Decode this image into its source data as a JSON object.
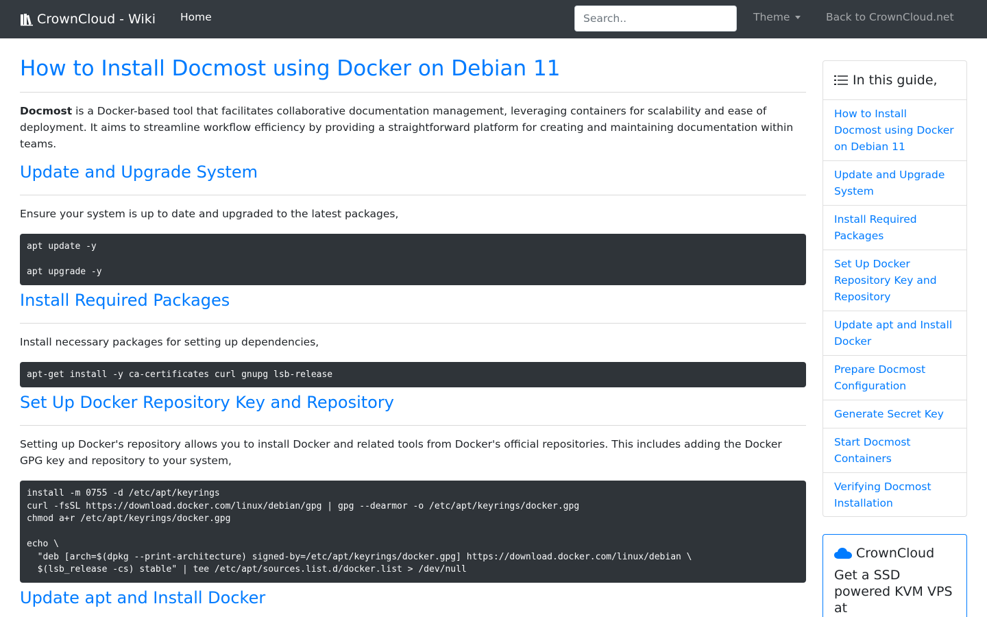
{
  "navbar": {
    "brand": "CrownCloud - Wiki",
    "home": "Home",
    "search_placeholder": "Search..",
    "theme": "Theme",
    "back_link": "Back to CrownCloud.net"
  },
  "article": {
    "title": "How to Install Docmost using Docker on Debian 11",
    "intro_bold": "Docmost",
    "intro_rest": " is a Docker-based tool that facilitates collaborative documentation management, leveraging containers for scalability and ease of deployment. It aims to streamline workflow efficiency by providing a straightforward platform for creating and maintaining documentation within teams.",
    "sections": [
      {
        "heading": "Update and Upgrade System",
        "text": "Ensure your system is up to date and upgraded to the latest packages,",
        "code": "apt update -y\n\napt upgrade -y"
      },
      {
        "heading": "Install Required Packages",
        "text": "Install necessary packages for setting up dependencies,",
        "code": "apt-get install -y ca-certificates curl gnupg lsb-release"
      },
      {
        "heading": "Set Up Docker Repository Key and Repository",
        "text": "Setting up Docker's repository allows you to install Docker and related tools from Docker's official repositories. This includes adding the Docker GPG key and repository to your system,",
        "code": "install -m 0755 -d /etc/apt/keyrings\ncurl -fsSL https://download.docker.com/linux/debian/gpg | gpg --dearmor -o /etc/apt/keyrings/docker.gpg\nchmod a+r /etc/apt/keyrings/docker.gpg\n\necho \\\n  \"deb [arch=$(dpkg --print-architecture) signed-by=/etc/apt/keyrings/docker.gpg] https://download.docker.com/linux/debian \\\n  $(lsb_release -cs) stable\" | tee /etc/apt/sources.list.d/docker.list > /dev/null"
      },
      {
        "heading": "Update apt and Install Docker"
      }
    ]
  },
  "sidebar": {
    "toc_title": "In this guide,",
    "toc_items": [
      "How to Install Docmost using Docker on Debian 11",
      "Update and Upgrade System",
      "Install Required Packages",
      "Set Up Docker Repository Key and Repository",
      "Update apt and Install Docker",
      "Prepare Docmost Configuration",
      "Generate Secret Key",
      "Start Docmost Containers",
      "Verifying Docmost Installation"
    ],
    "ad_title": "CrownCloud",
    "ad_text": "Get a SSD powered KVM VPS at"
  },
  "colors": {
    "navbar_bg": "#343a40",
    "link": "#007bff",
    "code_bg": "#2f3439"
  },
  "icons": {
    "brand": "books-icon",
    "toc": "list-icon",
    "ad": "cloud-icon"
  }
}
